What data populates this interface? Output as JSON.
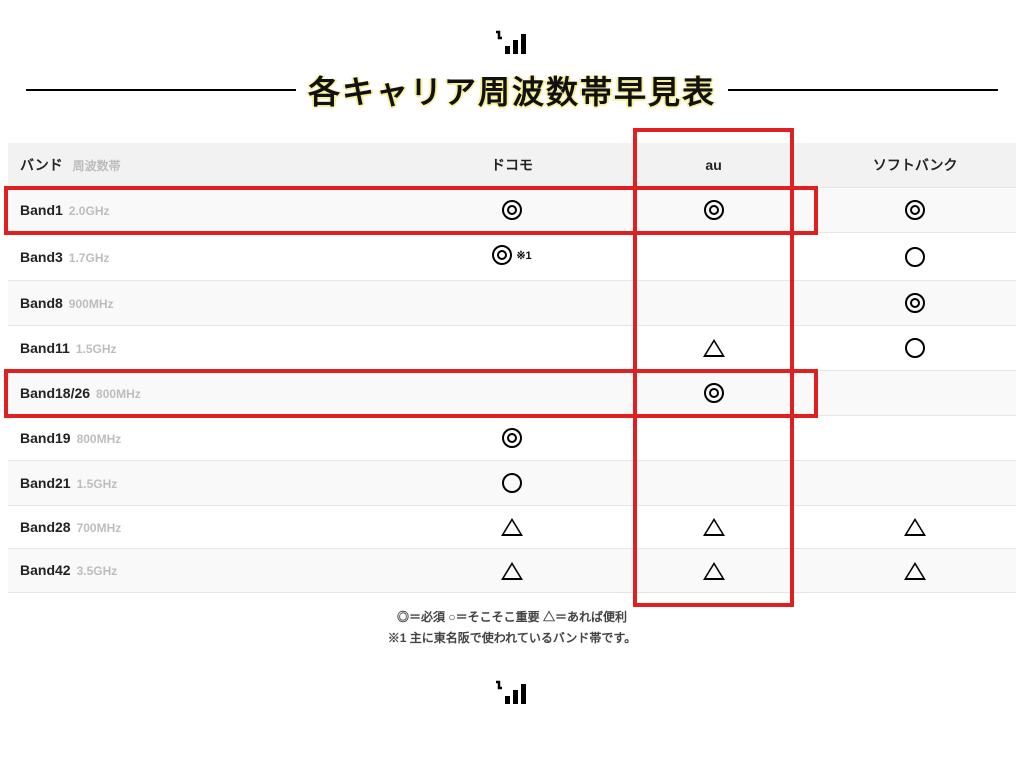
{
  "heading": {
    "title": "各キャリア周波数帯早見表"
  },
  "table": {
    "headers": {
      "band_label": "バンド",
      "band_sub": "周波数帯",
      "carrier1": "ドコモ",
      "carrier2": "au",
      "carrier3": "ソフトバンク"
    },
    "rows": [
      {
        "band": "Band1",
        "freq": "2.0GHz",
        "c1": "double",
        "c1_note": "",
        "c2": "double",
        "c3": "double"
      },
      {
        "band": "Band3",
        "freq": "1.7GHz",
        "c1": "double",
        "c1_note": "※1",
        "c2": "",
        "c3": "single"
      },
      {
        "band": "Band8",
        "freq": "900MHz",
        "c1": "",
        "c1_note": "",
        "c2": "",
        "c3": "double"
      },
      {
        "band": "Band11",
        "freq": "1.5GHz",
        "c1": "",
        "c1_note": "",
        "c2": "tri",
        "c3": "single"
      },
      {
        "band": "Band18/26",
        "freq": "800MHz",
        "c1": "",
        "c1_note": "",
        "c2": "double",
        "c3": ""
      },
      {
        "band": "Band19",
        "freq": "800MHz",
        "c1": "double",
        "c1_note": "",
        "c2": "",
        "c3": ""
      },
      {
        "band": "Band21",
        "freq": "1.5GHz",
        "c1": "single",
        "c1_note": "",
        "c2": "",
        "c3": ""
      },
      {
        "band": "Band28",
        "freq": "700MHz",
        "c1": "tri",
        "c1_note": "",
        "c2": "tri",
        "c3": "tri"
      },
      {
        "band": "Band42",
        "freq": "3.5GHz",
        "c1": "tri",
        "c1_note": "",
        "c2": "tri",
        "c3": "tri"
      }
    ]
  },
  "legend": {
    "line1": "◎＝必須 ○＝そこそこ重要 △＝あれば便利",
    "line2": "※1 主に東名阪で使われているバンド帯です。"
  },
  "highlights": {
    "au_column": true,
    "row_band1": true,
    "row_band18_26": true
  }
}
